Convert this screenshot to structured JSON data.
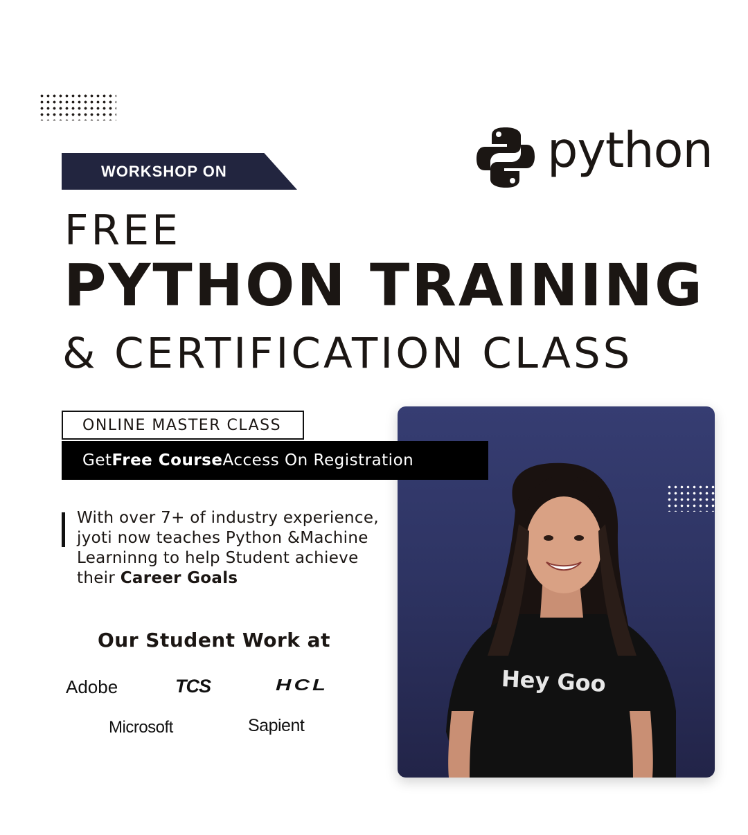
{
  "banner": {
    "label": "WORKSHOP ON"
  },
  "brand": {
    "wordmark": "python"
  },
  "headline": {
    "line1": "FREE",
    "line2": "PYTHON TRAINING",
    "line3": "& CERTIFICATION CLASS"
  },
  "master_class": {
    "label": "ONLINE MASTER CLASS",
    "registration_pre": "Get ",
    "registration_bold": "Free Course",
    "registration_post": " Access On Registration"
  },
  "bio": {
    "text": "With over 7+ of industry experience, jyoti now teaches Python &Machine Learninng to help Student achieve their ",
    "bold": "Career Goals"
  },
  "students": {
    "heading": "Our Student Work at",
    "companies": [
      "Adobe",
      "TCS",
      "HCL",
      "Microsoft",
      "Sapient"
    ]
  },
  "photo": {
    "shirt_text": "Hey Goo"
  },
  "colors": {
    "navy": "#22253f",
    "card": "#2e3463",
    "ink": "#1b1613",
    "python_logo": "#1b1613"
  },
  "icons": [
    "dot-grid-icon",
    "python-logo-icon"
  ]
}
